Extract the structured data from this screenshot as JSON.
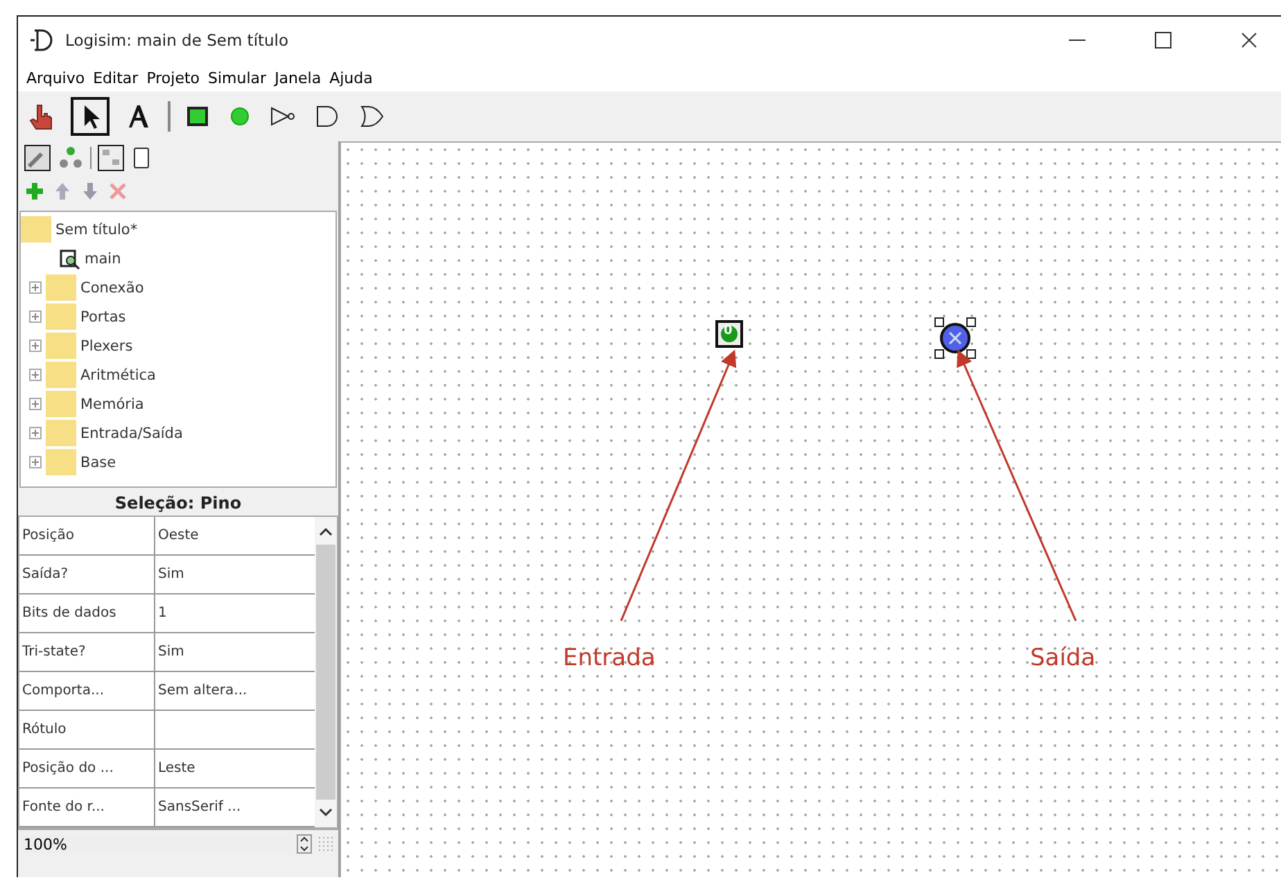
{
  "window": {
    "title": "Logisim: main de Sem título"
  },
  "menu": [
    "Arquivo",
    "Editar",
    "Projeto",
    "Simular",
    "Janela",
    "Ajuda"
  ],
  "tree": {
    "label": "Sem título*",
    "children": [
      {
        "label": "main",
        "kind": "circuit"
      },
      {
        "label": "Conexão",
        "kind": "library",
        "expanded": false
      },
      {
        "label": "Portas",
        "kind": "library",
        "expanded": false
      },
      {
        "label": "Plexers",
        "kind": "library",
        "expanded": false
      },
      {
        "label": "Aritmética",
        "kind": "library",
        "expanded": false
      },
      {
        "label": "Memória",
        "kind": "library",
        "expanded": false
      },
      {
        "label": "Entrada/Saída",
        "kind": "library",
        "expanded": false
      },
      {
        "label": "Base",
        "kind": "library",
        "expanded": false
      }
    ]
  },
  "properties": {
    "title": "Seleção: Pino",
    "rows": [
      {
        "name": "Posição",
        "value": "Oeste"
      },
      {
        "name": "Saída?",
        "value": "Sim"
      },
      {
        "name": "Bits de dados",
        "value": "1"
      },
      {
        "name": "Tri-state?",
        "value": "Sim"
      },
      {
        "name": "Comporta...",
        "value": "Sem altera..."
      },
      {
        "name": "Rótulo"
      },
      {
        "name": "Posição do ...",
        "value": "Leste"
      },
      {
        "name": "Fonte do r...",
        "value": "SansSerif ..."
      }
    ]
  },
  "zoom": "100%",
  "canvas": {
    "components": [
      {
        "kind": "input",
        "value": "0",
        "selected": false
      },
      {
        "kind": "output",
        "selected": true
      }
    ],
    "annotations": [
      {
        "text": "Entrada"
      },
      {
        "text": "Saída"
      }
    ]
  }
}
